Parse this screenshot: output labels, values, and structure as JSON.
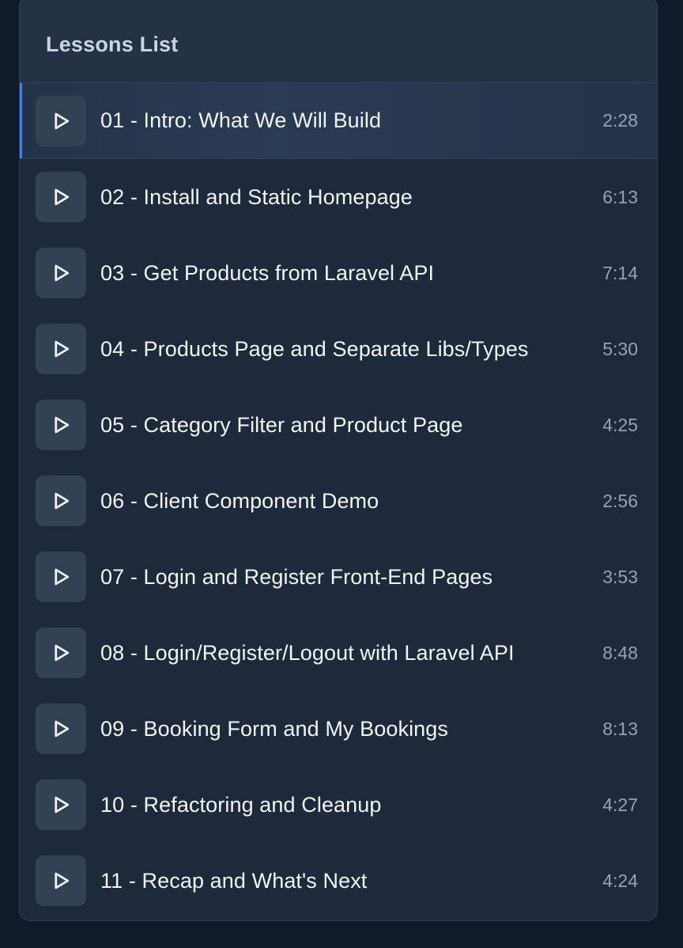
{
  "panel": {
    "title": "Lessons List"
  },
  "accent_color": "#3b82f6",
  "lessons": [
    {
      "title": "01 - Intro: What We Will Build",
      "duration": "2:28",
      "active": true
    },
    {
      "title": "02 - Install and Static Homepage",
      "duration": "6:13"
    },
    {
      "title": "03 - Get Products from Laravel API",
      "duration": "7:14"
    },
    {
      "title": "04 - Products Page and Separate Libs/Types",
      "duration": "5:30"
    },
    {
      "title": "05 - Category Filter and Product Page",
      "duration": "4:25"
    },
    {
      "title": "06 - Client Component Demo",
      "duration": "2:56"
    },
    {
      "title": "07 - Login and Register Front-End Pages",
      "duration": "3:53"
    },
    {
      "title": "08 - Login/Register/Logout with Laravel API",
      "duration": "8:48"
    },
    {
      "title": "09 - Booking Form and My Bookings",
      "duration": "8:13"
    },
    {
      "title": "10 - Refactoring and Cleanup",
      "duration": "4:27"
    },
    {
      "title": "11 - Recap and What's Next",
      "duration": "4:24"
    }
  ],
  "icons": {
    "lesson_icon": "play-icon"
  }
}
